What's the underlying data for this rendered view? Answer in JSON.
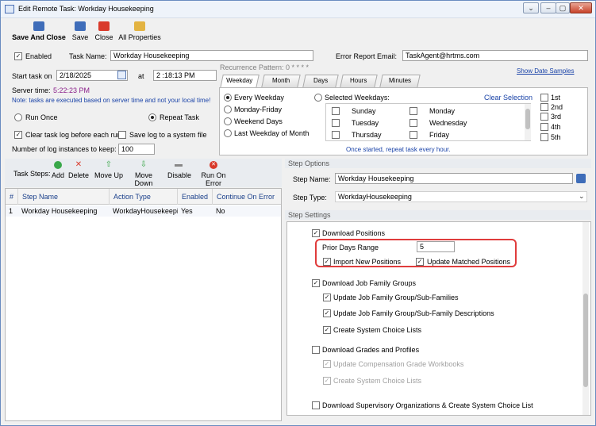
{
  "window": {
    "title": "Edit Remote Task: Workday Housekeeping",
    "controls": [
      "⌄",
      "–",
      "▢",
      "✕"
    ]
  },
  "toolbar": {
    "save_and_close": "Save And Close",
    "save": "Save",
    "close": "Close",
    "all_properties": "All Properties"
  },
  "header": {
    "enabled_label": "Enabled",
    "task_name_label": "Task Name:",
    "task_name_value": "Workday Housekeeping",
    "error_email_label": "Error Report Email:",
    "error_email_value": "TaskAgent@hrtms.com"
  },
  "schedule": {
    "start_label": "Start task on",
    "start_date": "2/18/2025",
    "at_label": "at",
    "start_time": "2 :18:13 PM",
    "server_time_label": "Server time:",
    "server_time_value": "5:22:23 PM",
    "note": "Note: tasks are executed based on server time and not your local time!",
    "run_once": "Run Once",
    "repeat_task": "Repeat Task",
    "clear_log": "Clear task log before each run",
    "save_log": "Save log to a system file",
    "log_instances_label": "Number of log instances to keep:",
    "log_instances_value": "100"
  },
  "recurrence": {
    "label": "Recurrence Pattern: 0 * * * *",
    "show_date_samples": "Show Date Samples",
    "tabs": [
      "Weekday",
      "Month",
      "Days",
      "Hours",
      "Minutes"
    ],
    "options": [
      "Every Weekday",
      "Monday-Friday",
      "Weekend Days",
      "Last Weekday of Month"
    ],
    "selected_weekdays": "Selected Weekdays:",
    "clear_selection": "Clear Selection",
    "days_col1": [
      "Sunday",
      "Tuesday",
      "Thursday"
    ],
    "days_col2": [
      "Monday",
      "Wednesday",
      "Friday"
    ],
    "weeks": [
      "1st",
      "2nd",
      "3rd",
      "4th",
      "5th"
    ],
    "footer_note": "Once started, repeat task every hour."
  },
  "steps": {
    "label": "Task Steps:",
    "buttons": {
      "add": "Add",
      "delete": "Delete",
      "move_up": "Move Up",
      "move_down": "Move Down",
      "disable": "Disable",
      "run_on_error": "Run On Error"
    },
    "columns": [
      "#",
      "Step Name",
      "Action Type",
      "Enabled",
      "Continue On Error"
    ],
    "rows": [
      {
        "num": "1",
        "name": "Workday Housekeeping",
        "action": "WorkdayHousekeeping",
        "enabled": "Yes",
        "continue": "No"
      }
    ]
  },
  "step_options": {
    "section_label": "Step Options",
    "step_name_label": "Step Name:",
    "step_name_value": "Workday Housekeeping",
    "step_type_label": "Step Type:",
    "step_type_value": "WorkdayHousekeeping"
  },
  "step_settings": {
    "section_label": "Step Settings",
    "download_positions": "Download Positions",
    "prior_days_label": "Prior Days Range",
    "prior_days_value": "5",
    "import_new_positions": "Import New Positions",
    "update_matched_positions": "Update Matched Positions",
    "download_job_family": "Download Job Family Groups",
    "update_job_family": "Update Job Family Group/Sub-Families",
    "update_job_family_desc": "Update Job Family Group/Sub-Family Descriptions",
    "create_choice_lists": "Create System Choice Lists",
    "download_grades": "Download Grades and Profiles",
    "update_comp_grade": "Update Compensation Grade Workbooks",
    "create_choice_lists_2": "Create System Choice Lists",
    "download_sup_orgs": "Download Supervisory Organizations & Create System Choice List"
  },
  "colors": {
    "accent_blue": "#1a43a8",
    "highlight_red": "#e03c3c"
  }
}
